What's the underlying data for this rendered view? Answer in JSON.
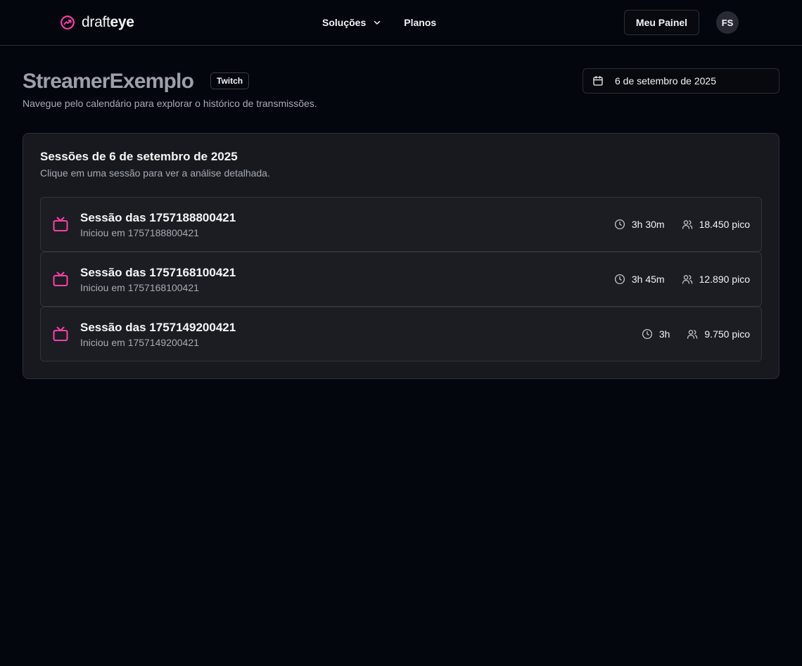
{
  "brand": {
    "name_light": "draft",
    "name_bold": "eye",
    "logo_icon": "chart-trend-icon",
    "accent": "#ff3fa8"
  },
  "nav": {
    "links": [
      {
        "label": "Soluções",
        "has_dropdown": true
      },
      {
        "label": "Planos",
        "has_dropdown": false
      }
    ],
    "panel_button": "Meu Painel",
    "avatar_initials": "FS"
  },
  "header": {
    "streamer_name": "StreamerExemplo",
    "platform": "Twitch",
    "subtitle": "Navegue pelo calendário para explorar o histórico de transmissões.",
    "selected_date": "6 de setembro de 2025"
  },
  "sessions_card": {
    "title": "Sessões de 6 de setembro de 2025",
    "description": "Clique em uma sessão para ver a análise detalhada.",
    "sessions": [
      {
        "title": "Sessão das 1757188800421",
        "started": "Iniciou em 1757188800421",
        "duration": "3h 30m",
        "peak": "18.450 pico"
      },
      {
        "title": "Sessão das 1757168100421",
        "started": "Iniciou em 1757168100421",
        "duration": "3h 45m",
        "peak": "12.890 pico"
      },
      {
        "title": "Sessão das 1757149200421",
        "started": "Iniciou em 1757149200421",
        "duration": "3h",
        "peak": "9.750 pico"
      }
    ]
  },
  "colors": {
    "background": "#04060d",
    "card": "#17191e",
    "accent_pink": "#ff3fa8",
    "muted_text": "#a6aab4"
  }
}
